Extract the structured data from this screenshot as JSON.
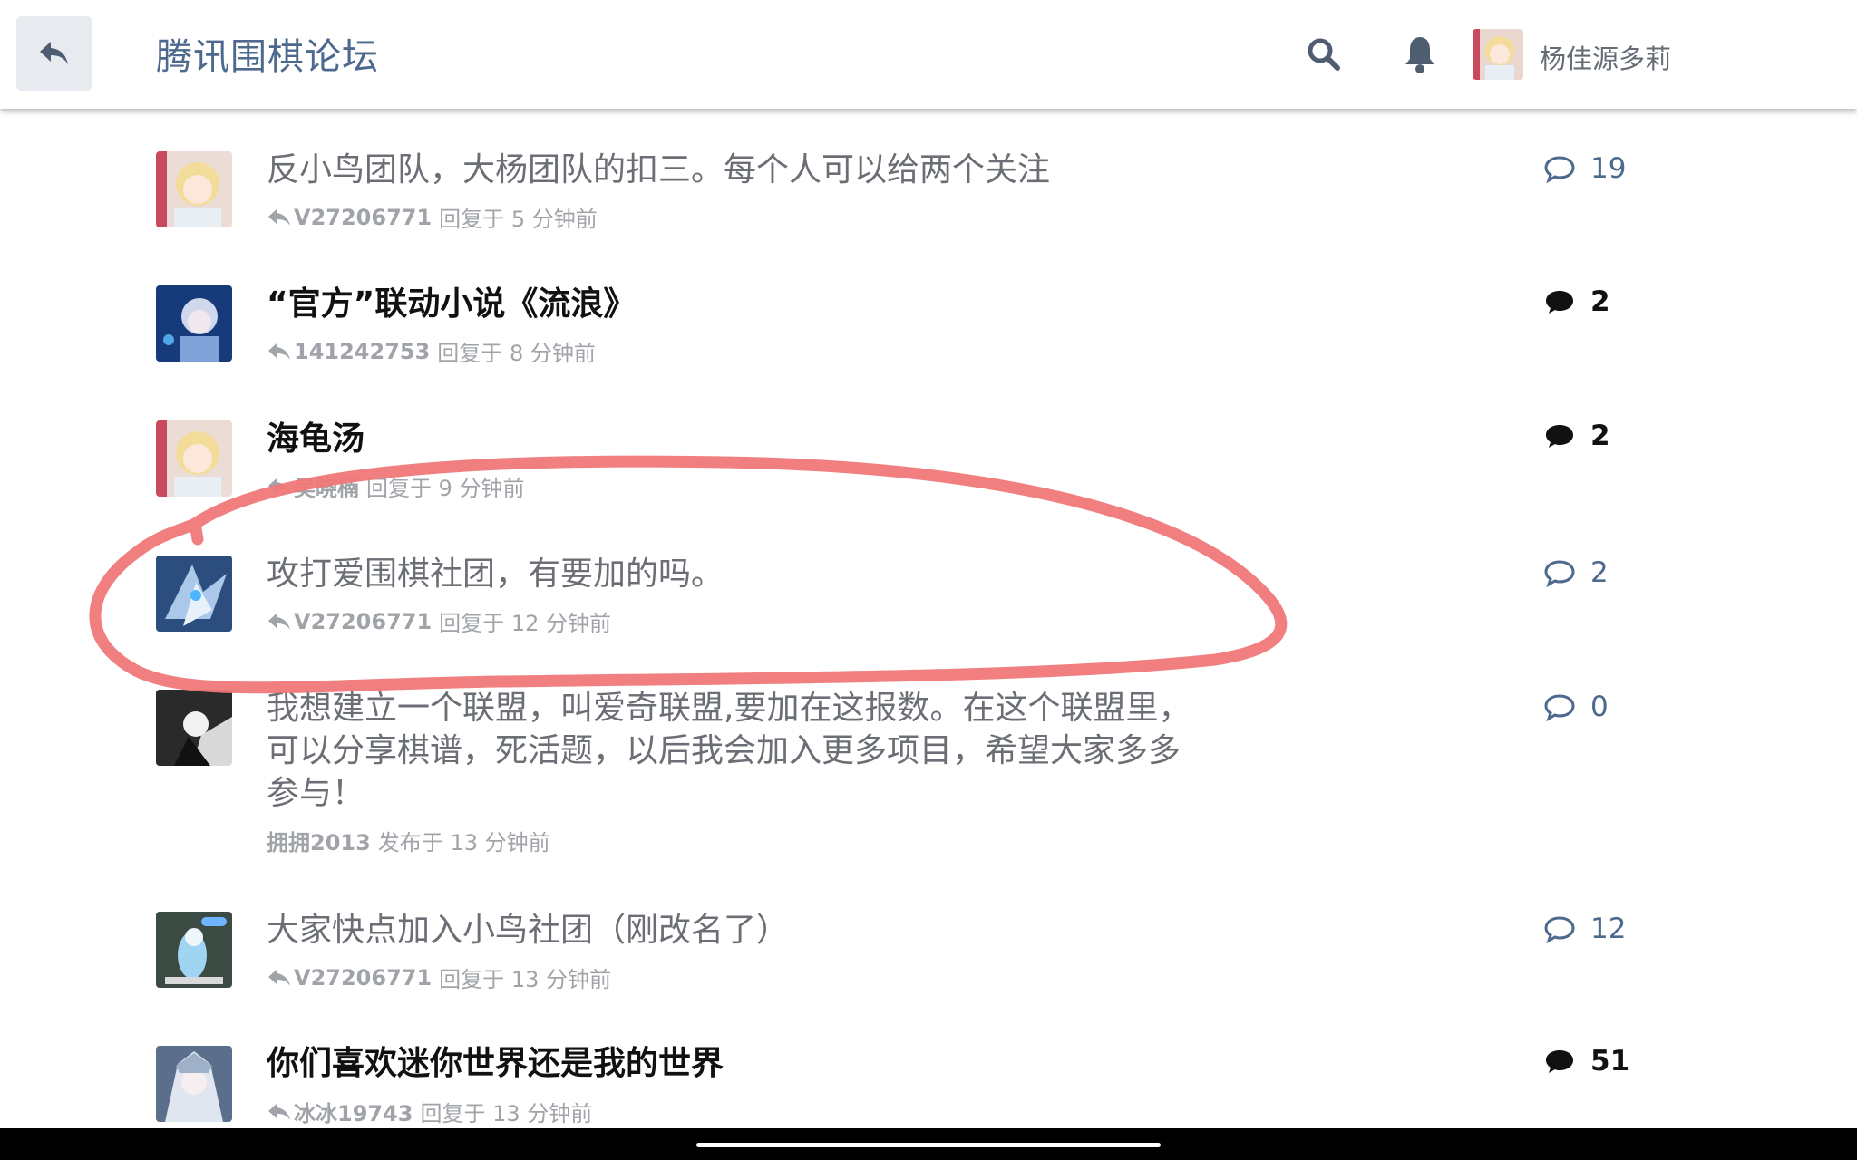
{
  "header": {
    "forum_title": "腾讯围棋论坛",
    "username": "杨佳源多莉",
    "icons": {
      "back": "reply-arrow-icon",
      "search": "search-icon",
      "notifications": "bell-icon"
    },
    "accent_color": "#4d698e"
  },
  "discussions": [
    {
      "title": "反小鸟团队，大杨团队的扣三。每个人可以给两个关注",
      "user": "V27206771",
      "action": "回复于",
      "time": "5 分钟前",
      "replies": "19",
      "unread": false
    },
    {
      "title": "“官方”联动小说《流浪》",
      "user": "141242753",
      "action": "回复于",
      "time": "8 分钟前",
      "replies": "2",
      "unread": true
    },
    {
      "title": "海龟汤",
      "user": "吴晓楠",
      "action": "回复于",
      "time": "9 分钟前",
      "replies": "2",
      "unread": true
    },
    {
      "title": "攻打爱围棋社团，有要加的吗。",
      "user": "V27206771",
      "action": "回复于",
      "time": "12 分钟前",
      "replies": "2",
      "unread": false
    },
    {
      "title": "我想建立一个联盟，叫爱奇联盟,要加在这报数。在这个联盟里，可以分享棋谱，死活题，以后我会加入更多项目，希望大家多多参与！",
      "user": "拥拥2013",
      "action": "发布于",
      "time": "13 分钟前",
      "replies": "0",
      "unread": false
    },
    {
      "title": "大家快点加入小鸟社团（刚改名了）",
      "user": "V27206771",
      "action": "回复于",
      "time": "13 分钟前",
      "replies": "12",
      "unread": false
    },
    {
      "title": "你们喜欢迷你世界还是我的世界",
      "user": "冰冰19743",
      "action": "回复于",
      "time": "13 分钟前",
      "replies": "51",
      "unread": true
    }
  ],
  "annotation": {
    "shape": "hand-drawn ellipse",
    "color": "#f07878"
  }
}
